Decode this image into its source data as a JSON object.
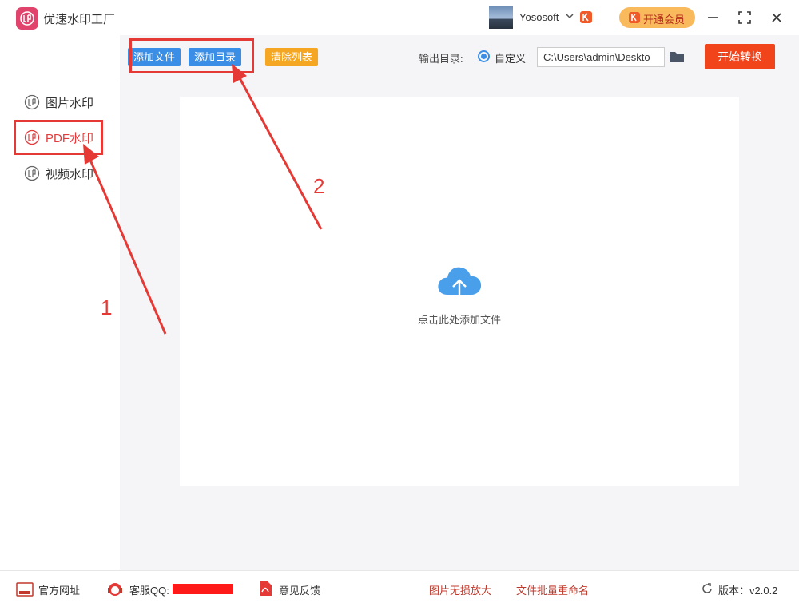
{
  "app": {
    "title": "优速水印工厂"
  },
  "user": {
    "name": "Yososoft",
    "vip_label": "开通会员"
  },
  "sidebar": {
    "items": [
      {
        "label": "图片水印",
        "active": false
      },
      {
        "label": "PDF水印",
        "active": true
      },
      {
        "label": "视频水印",
        "active": false
      }
    ]
  },
  "toolbar": {
    "add_file_label": "添加文件",
    "add_dir_label": "添加目录",
    "clear_label": "清除列表",
    "output_dir_label": "输出目录:",
    "custom_label": "自定义",
    "path_value": "C:\\Users\\admin\\Deskto",
    "start_label": "开始转换"
  },
  "dropzone": {
    "hint": "点击此处添加文件"
  },
  "annotations": {
    "step1": "1",
    "step2": "2",
    "color": "#e53935"
  },
  "footer": {
    "website": "官方网址",
    "qq": "客服QQ:",
    "feedback": "意见反馈",
    "upscale": "图片无损放大",
    "rename": "文件批量重命名",
    "version": "版本：v2.0.2"
  },
  "colors": {
    "accent": "#3a8ee6",
    "start": "#f2441b",
    "brand": "#e0436b"
  }
}
